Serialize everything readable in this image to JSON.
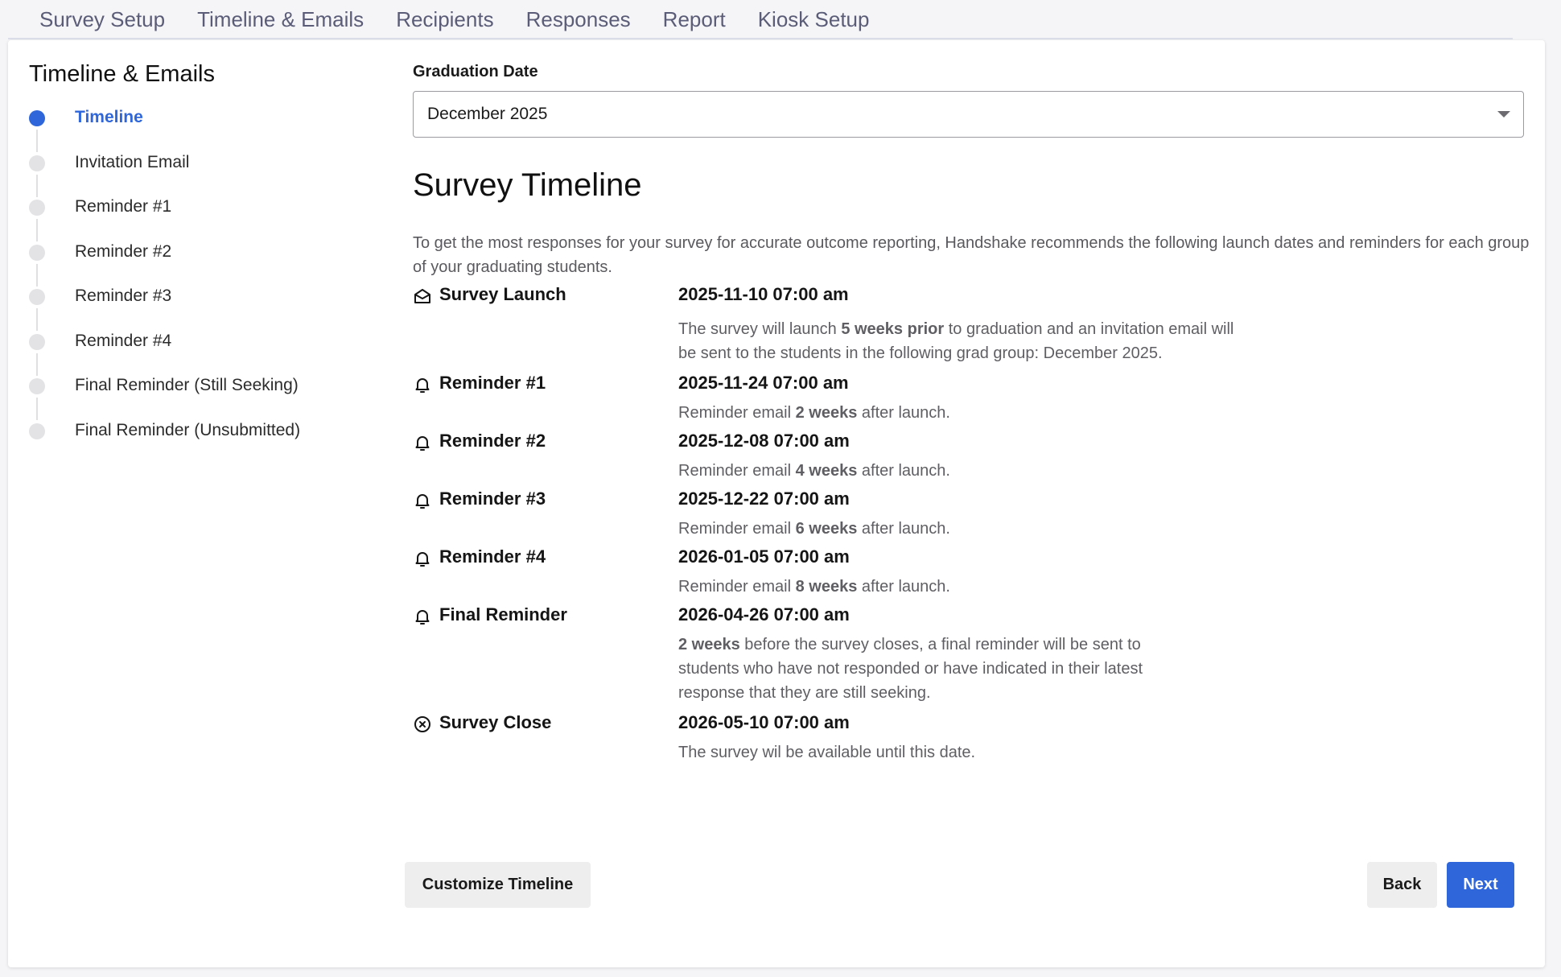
{
  "top_tabs": [
    "Survey Setup",
    "Timeline & Emails",
    "Recipients",
    "Responses",
    "Report",
    "Kiosk Setup"
  ],
  "sidebar": {
    "title": "Timeline & Emails",
    "steps": [
      {
        "label": "Timeline",
        "active": true
      },
      {
        "label": "Invitation Email",
        "active": false
      },
      {
        "label": "Reminder #1",
        "active": false
      },
      {
        "label": "Reminder #2",
        "active": false
      },
      {
        "label": "Reminder #3",
        "active": false
      },
      {
        "label": "Reminder #4",
        "active": false
      },
      {
        "label": "Final Reminder (Still Seeking)",
        "active": false
      },
      {
        "label": "Final Reminder (Unsubmitted)",
        "active": false
      }
    ]
  },
  "graduation": {
    "label": "Graduation Date",
    "selected": "December 2025"
  },
  "survey_timeline": {
    "title": "Survey Timeline",
    "intro": "To get the most responses for your survey for accurate outcome reporting, Handshake recommends the following launch dates and reminders for each group of your graduating students.",
    "items": [
      {
        "icon": "envelope-open-icon",
        "name": "Survey Launch",
        "date": "2025-11-10 07:00 am",
        "desc_pre": "The survey will launch ",
        "desc_bold": "5 weeks prior",
        "desc_post": " to graduation and an invitation email will be sent to the students in the following grad group: December 2025."
      },
      {
        "icon": "bell-icon",
        "name": "Reminder #1",
        "date": "2025-11-24 07:00 am",
        "desc_pre": "Reminder email ",
        "desc_bold": "2 weeks",
        "desc_post": " after launch."
      },
      {
        "icon": "bell-icon",
        "name": "Reminder #2",
        "date": "2025-12-08 07:00 am",
        "desc_pre": "Reminder email ",
        "desc_bold": "4 weeks",
        "desc_post": " after launch."
      },
      {
        "icon": "bell-icon",
        "name": "Reminder #3",
        "date": "2025-12-22 07:00 am",
        "desc_pre": "Reminder email ",
        "desc_bold": "6 weeks",
        "desc_post": " after launch."
      },
      {
        "icon": "bell-icon",
        "name": "Reminder #4",
        "date": "2026-01-05 07:00 am",
        "desc_pre": "Reminder email ",
        "desc_bold": "8 weeks",
        "desc_post": " after launch."
      },
      {
        "icon": "bell-icon",
        "name": "Final Reminder",
        "date": "2026-04-26 07:00 am",
        "desc_pre": "",
        "desc_bold": "2 weeks",
        "desc_post": " before the survey closes, a final reminder will be sent to students who have not responded or have indicated in their latest response that they are still seeking."
      },
      {
        "icon": "close-circle-icon",
        "name": "Survey Close",
        "date": "2026-05-10 07:00 am",
        "desc_pre": "The survey wil be available until this date.",
        "desc_bold": "",
        "desc_post": ""
      }
    ]
  },
  "buttons": {
    "customize": "Customize Timeline",
    "back": "Back",
    "next": "Next"
  },
  "colors": {
    "accent": "#2f67db",
    "tab_text": "#5b5d78"
  }
}
